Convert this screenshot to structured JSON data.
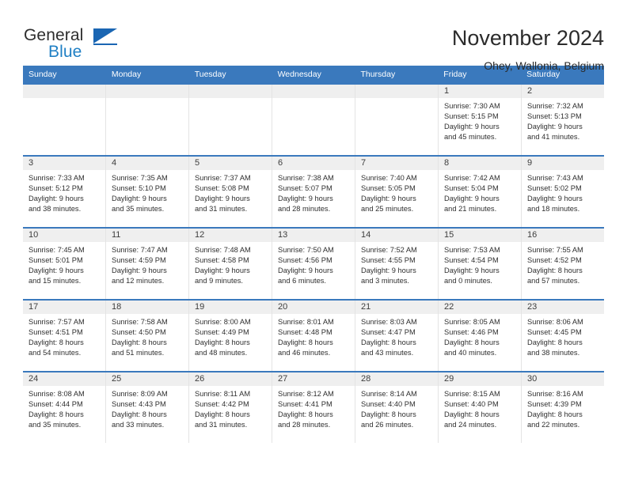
{
  "brand": {
    "name_part1": "General",
    "name_part2": "Blue",
    "accent_color": "#1a66b3"
  },
  "header": {
    "title": "November 2024",
    "subtitle": "Ohey, Wallonia, Belgium"
  },
  "calendar": {
    "header_bg": "#3a79bd",
    "weekdays": [
      "Sunday",
      "Monday",
      "Tuesday",
      "Wednesday",
      "Thursday",
      "Friday",
      "Saturday"
    ],
    "weeks": [
      [
        {
          "day": "",
          "sunrise": "",
          "sunset": "",
          "daylight_line1": "",
          "daylight_line2": "",
          "empty": true
        },
        {
          "day": "",
          "sunrise": "",
          "sunset": "",
          "daylight_line1": "",
          "daylight_line2": "",
          "empty": true
        },
        {
          "day": "",
          "sunrise": "",
          "sunset": "",
          "daylight_line1": "",
          "daylight_line2": "",
          "empty": true
        },
        {
          "day": "",
          "sunrise": "",
          "sunset": "",
          "daylight_line1": "",
          "daylight_line2": "",
          "empty": true
        },
        {
          "day": "",
          "sunrise": "",
          "sunset": "",
          "daylight_line1": "",
          "daylight_line2": "",
          "empty": true
        },
        {
          "day": "1",
          "sunrise": "Sunrise: 7:30 AM",
          "sunset": "Sunset: 5:15 PM",
          "daylight_line1": "Daylight: 9 hours",
          "daylight_line2": "and 45 minutes."
        },
        {
          "day": "2",
          "sunrise": "Sunrise: 7:32 AM",
          "sunset": "Sunset: 5:13 PM",
          "daylight_line1": "Daylight: 9 hours",
          "daylight_line2": "and 41 minutes."
        }
      ],
      [
        {
          "day": "3",
          "sunrise": "Sunrise: 7:33 AM",
          "sunset": "Sunset: 5:12 PM",
          "daylight_line1": "Daylight: 9 hours",
          "daylight_line2": "and 38 minutes."
        },
        {
          "day": "4",
          "sunrise": "Sunrise: 7:35 AM",
          "sunset": "Sunset: 5:10 PM",
          "daylight_line1": "Daylight: 9 hours",
          "daylight_line2": "and 35 minutes."
        },
        {
          "day": "5",
          "sunrise": "Sunrise: 7:37 AM",
          "sunset": "Sunset: 5:08 PM",
          "daylight_line1": "Daylight: 9 hours",
          "daylight_line2": "and 31 minutes."
        },
        {
          "day": "6",
          "sunrise": "Sunrise: 7:38 AM",
          "sunset": "Sunset: 5:07 PM",
          "daylight_line1": "Daylight: 9 hours",
          "daylight_line2": "and 28 minutes."
        },
        {
          "day": "7",
          "sunrise": "Sunrise: 7:40 AM",
          "sunset": "Sunset: 5:05 PM",
          "daylight_line1": "Daylight: 9 hours",
          "daylight_line2": "and 25 minutes."
        },
        {
          "day": "8",
          "sunrise": "Sunrise: 7:42 AM",
          "sunset": "Sunset: 5:04 PM",
          "daylight_line1": "Daylight: 9 hours",
          "daylight_line2": "and 21 minutes."
        },
        {
          "day": "9",
          "sunrise": "Sunrise: 7:43 AM",
          "sunset": "Sunset: 5:02 PM",
          "daylight_line1": "Daylight: 9 hours",
          "daylight_line2": "and 18 minutes."
        }
      ],
      [
        {
          "day": "10",
          "sunrise": "Sunrise: 7:45 AM",
          "sunset": "Sunset: 5:01 PM",
          "daylight_line1": "Daylight: 9 hours",
          "daylight_line2": "and 15 minutes."
        },
        {
          "day": "11",
          "sunrise": "Sunrise: 7:47 AM",
          "sunset": "Sunset: 4:59 PM",
          "daylight_line1": "Daylight: 9 hours",
          "daylight_line2": "and 12 minutes."
        },
        {
          "day": "12",
          "sunrise": "Sunrise: 7:48 AM",
          "sunset": "Sunset: 4:58 PM",
          "daylight_line1": "Daylight: 9 hours",
          "daylight_line2": "and 9 minutes."
        },
        {
          "day": "13",
          "sunrise": "Sunrise: 7:50 AM",
          "sunset": "Sunset: 4:56 PM",
          "daylight_line1": "Daylight: 9 hours",
          "daylight_line2": "and 6 minutes."
        },
        {
          "day": "14",
          "sunrise": "Sunrise: 7:52 AM",
          "sunset": "Sunset: 4:55 PM",
          "daylight_line1": "Daylight: 9 hours",
          "daylight_line2": "and 3 minutes."
        },
        {
          "day": "15",
          "sunrise": "Sunrise: 7:53 AM",
          "sunset": "Sunset: 4:54 PM",
          "daylight_line1": "Daylight: 9 hours",
          "daylight_line2": "and 0 minutes."
        },
        {
          "day": "16",
          "sunrise": "Sunrise: 7:55 AM",
          "sunset": "Sunset: 4:52 PM",
          "daylight_line1": "Daylight: 8 hours",
          "daylight_line2": "and 57 minutes."
        }
      ],
      [
        {
          "day": "17",
          "sunrise": "Sunrise: 7:57 AM",
          "sunset": "Sunset: 4:51 PM",
          "daylight_line1": "Daylight: 8 hours",
          "daylight_line2": "and 54 minutes."
        },
        {
          "day": "18",
          "sunrise": "Sunrise: 7:58 AM",
          "sunset": "Sunset: 4:50 PM",
          "daylight_line1": "Daylight: 8 hours",
          "daylight_line2": "and 51 minutes."
        },
        {
          "day": "19",
          "sunrise": "Sunrise: 8:00 AM",
          "sunset": "Sunset: 4:49 PM",
          "daylight_line1": "Daylight: 8 hours",
          "daylight_line2": "and 48 minutes."
        },
        {
          "day": "20",
          "sunrise": "Sunrise: 8:01 AM",
          "sunset": "Sunset: 4:48 PM",
          "daylight_line1": "Daylight: 8 hours",
          "daylight_line2": "and 46 minutes."
        },
        {
          "day": "21",
          "sunrise": "Sunrise: 8:03 AM",
          "sunset": "Sunset: 4:47 PM",
          "daylight_line1": "Daylight: 8 hours",
          "daylight_line2": "and 43 minutes."
        },
        {
          "day": "22",
          "sunrise": "Sunrise: 8:05 AM",
          "sunset": "Sunset: 4:46 PM",
          "daylight_line1": "Daylight: 8 hours",
          "daylight_line2": "and 40 minutes."
        },
        {
          "day": "23",
          "sunrise": "Sunrise: 8:06 AM",
          "sunset": "Sunset: 4:45 PM",
          "daylight_line1": "Daylight: 8 hours",
          "daylight_line2": "and 38 minutes."
        }
      ],
      [
        {
          "day": "24",
          "sunrise": "Sunrise: 8:08 AM",
          "sunset": "Sunset: 4:44 PM",
          "daylight_line1": "Daylight: 8 hours",
          "daylight_line2": "and 35 minutes."
        },
        {
          "day": "25",
          "sunrise": "Sunrise: 8:09 AM",
          "sunset": "Sunset: 4:43 PM",
          "daylight_line1": "Daylight: 8 hours",
          "daylight_line2": "and 33 minutes."
        },
        {
          "day": "26",
          "sunrise": "Sunrise: 8:11 AM",
          "sunset": "Sunset: 4:42 PM",
          "daylight_line1": "Daylight: 8 hours",
          "daylight_line2": "and 31 minutes."
        },
        {
          "day": "27",
          "sunrise": "Sunrise: 8:12 AM",
          "sunset": "Sunset: 4:41 PM",
          "daylight_line1": "Daylight: 8 hours",
          "daylight_line2": "and 28 minutes."
        },
        {
          "day": "28",
          "sunrise": "Sunrise: 8:14 AM",
          "sunset": "Sunset: 4:40 PM",
          "daylight_line1": "Daylight: 8 hours",
          "daylight_line2": "and 26 minutes."
        },
        {
          "day": "29",
          "sunrise": "Sunrise: 8:15 AM",
          "sunset": "Sunset: 4:40 PM",
          "daylight_line1": "Daylight: 8 hours",
          "daylight_line2": "and 24 minutes."
        },
        {
          "day": "30",
          "sunrise": "Sunrise: 8:16 AM",
          "sunset": "Sunset: 4:39 PM",
          "daylight_line1": "Daylight: 8 hours",
          "daylight_line2": "and 22 minutes."
        }
      ]
    ]
  }
}
